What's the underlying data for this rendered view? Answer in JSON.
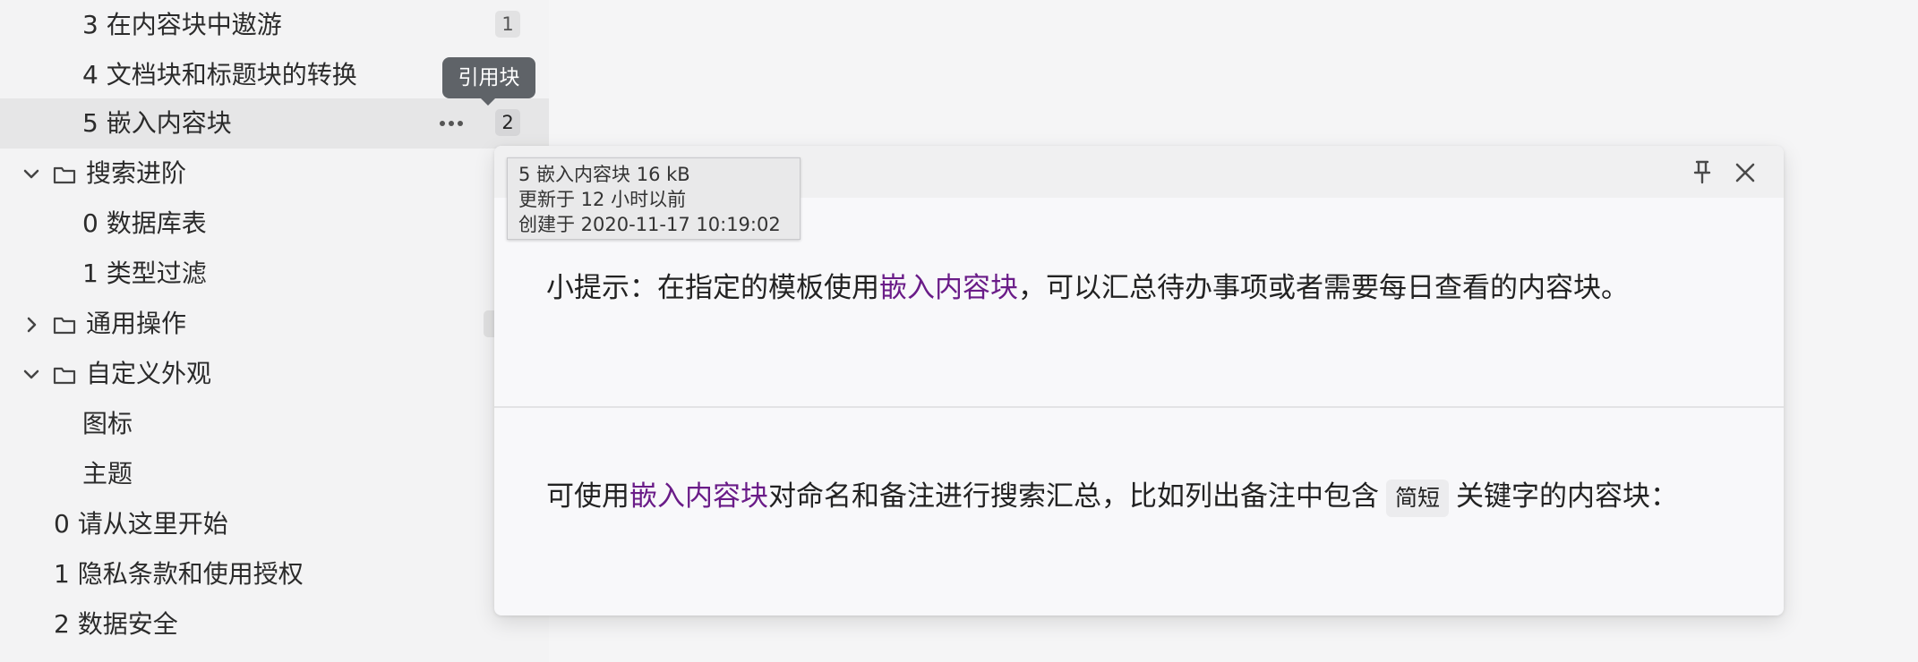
{
  "sidebar": {
    "items": [
      {
        "label": "3 在内容块中遨游",
        "count": "1"
      },
      {
        "label": "4 文档块和标题块的转换"
      },
      {
        "label": "5 嵌入内容块",
        "count": "2"
      },
      {
        "label": "搜索进阶",
        "icon": "folder-icon",
        "expanded": true
      },
      {
        "label": "0 数据库表"
      },
      {
        "label": "1 类型过滤"
      },
      {
        "label": "通用操作",
        "icon": "folder-icon",
        "expanded": false
      },
      {
        "label": "自定义外观",
        "icon": "folder-icon",
        "expanded": true
      },
      {
        "label": "图标"
      },
      {
        "label": "主题"
      },
      {
        "label": "0 请从这里开始"
      },
      {
        "label": "1 隐私条款和使用授权"
      },
      {
        "label": "2 数据安全"
      }
    ]
  },
  "tooltip": {
    "text": "引用块"
  },
  "info_tooltip": {
    "lines": [
      "5 嵌入内容块 16 kB",
      "更新于 12 小时以前",
      "创建于 2020-11-17 10:19:02"
    ]
  },
  "popup": {
    "paragraph1": {
      "before": "小提示：在指定的模板使用",
      "link": "嵌入内容块",
      "after": "，可以汇总待办事项或者需要每日查看的内容块。"
    },
    "paragraph2": {
      "before": "可使用",
      "link": "嵌入内容块",
      "middle": "对命名和备注进行搜索汇总，比如列出备注中包含",
      "code": "简短",
      "after": "关键字的内容块："
    }
  },
  "colors": {
    "link": "#6a1c88",
    "active_row": "#e6e6e7",
    "tooltip_bg": "#5f6368"
  }
}
